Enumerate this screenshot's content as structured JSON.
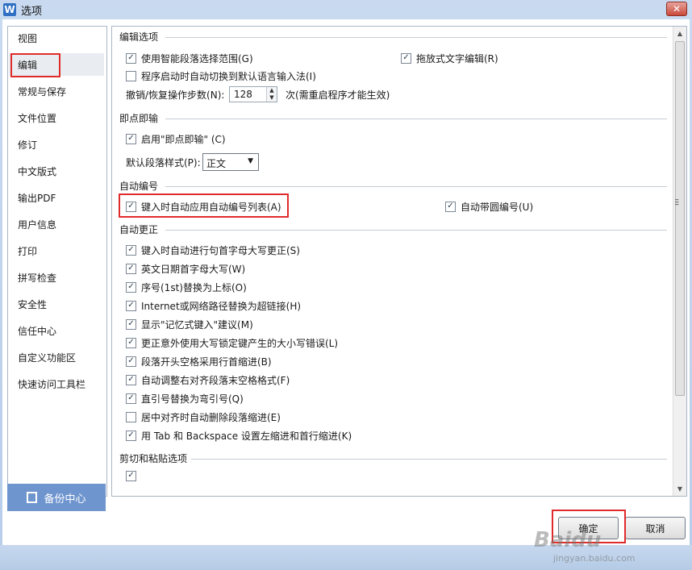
{
  "window": {
    "title": "选项",
    "app_icon": "W",
    "close_glyph": "✕"
  },
  "nav": {
    "items": [
      "视图",
      "编辑",
      "常规与保存",
      "文件位置",
      "修订",
      "中文版式",
      "输出PDF",
      "用户信息",
      "打印",
      "拼写检查",
      "安全性",
      "信任中心",
      "自定义功能区",
      "快速访问工具栏"
    ],
    "selected": "编辑"
  },
  "backup": {
    "label": "备份中心"
  },
  "sections": {
    "edit": {
      "title": "编辑选项",
      "smart_select": "使用智能段落选择范围(G)",
      "drag_drop": "拖放式文字编辑(R)",
      "auto_ime": "程序启动时自动切换到默认语言输入法(I)",
      "undo_label": "撤销/恢复操作步数(N):",
      "undo_value": "128",
      "undo_suffix": "次(需重启程序才能生效)"
    },
    "click_type": {
      "title": "即点即输",
      "enable": "启用\"即点即输\" (C)",
      "default_style_label": "默认段落样式(P):",
      "default_style_value": "正文"
    },
    "auto_number": {
      "title": "自动编号",
      "auto_list": "键入时自动应用自动编号列表(A)",
      "circle_number": "自动带圆编号(U)"
    },
    "auto_correct": {
      "title": "自动更正",
      "items": [
        {
          "label": "键入时自动进行句首字母大写更正(S)",
          "checked": true
        },
        {
          "label": "英文日期首字母大写(W)",
          "checked": true
        },
        {
          "label": "序号(1st)替换为上标(O)",
          "checked": true
        },
        {
          "label": "Internet或网络路径替换为超链接(H)",
          "checked": true
        },
        {
          "label": "显示\"记忆式键入\"建议(M)",
          "checked": true
        },
        {
          "label": "更正意外使用大写锁定键产生的大小写错误(L)",
          "checked": true
        },
        {
          "label": "段落开头空格采用行首缩进(B)",
          "checked": true
        },
        {
          "label": "自动调整右对齐段落末空格格式(F)",
          "checked": true
        },
        {
          "label": "直引号替换为弯引号(Q)",
          "checked": true
        },
        {
          "label": "居中对齐时自动删除段落缩进(E)",
          "checked": false
        },
        {
          "label": "用 Tab 和 Backspace 设置左缩进和首行缩进(K)",
          "checked": true
        }
      ]
    },
    "paste": {
      "title": "剪切和粘贴选项"
    }
  },
  "buttons": {
    "ok": "确定",
    "cancel": "取消"
  },
  "watermark": {
    "brand": "Baidu",
    "sub": "jingyan.baidu.com"
  },
  "colors": {
    "highlight_red": "#e02b2b",
    "backup_blue": "#6f95cf"
  }
}
